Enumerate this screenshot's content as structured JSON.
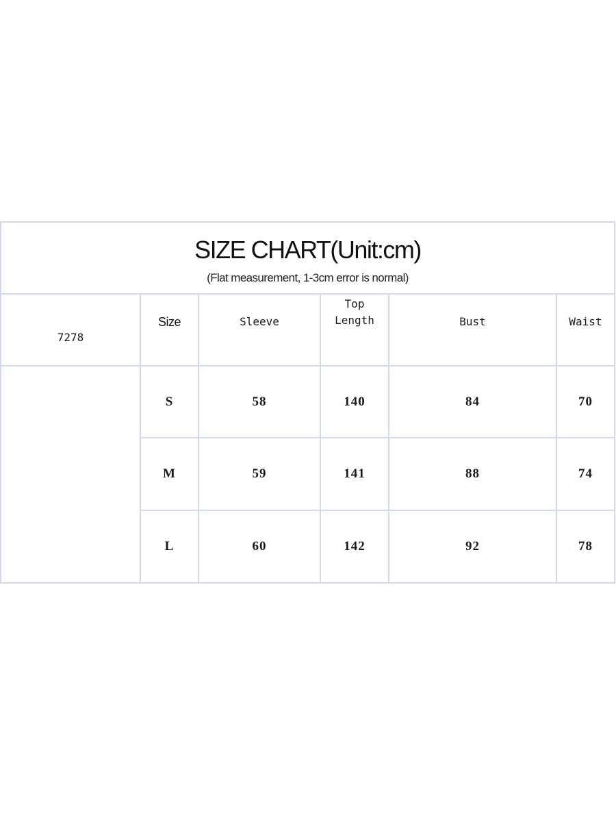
{
  "title": "SIZE CHART(Unit:cm)",
  "subtitle": "(Flat measurement, 1-3cm error is normal)",
  "style_code": "7278",
  "headers": {
    "size": "Size",
    "sleeve": "Sleeve",
    "top_length_line1": "Top",
    "top_length_line2": "Length",
    "bust": "Bust",
    "waist": "Waist"
  },
  "rows": [
    {
      "size": "S",
      "sleeve": "58",
      "top_length": "140",
      "bust": "84",
      "waist": "70"
    },
    {
      "size": "M",
      "sleeve": "59",
      "top_length": "141",
      "bust": "88",
      "waist": "74"
    },
    {
      "size": "L",
      "sleeve": "60",
      "top_length": "142",
      "bust": "92",
      "waist": "78"
    }
  ],
  "colors": {
    "border": "#d3d8ea",
    "text": "#111111",
    "background": "#ffffff"
  }
}
